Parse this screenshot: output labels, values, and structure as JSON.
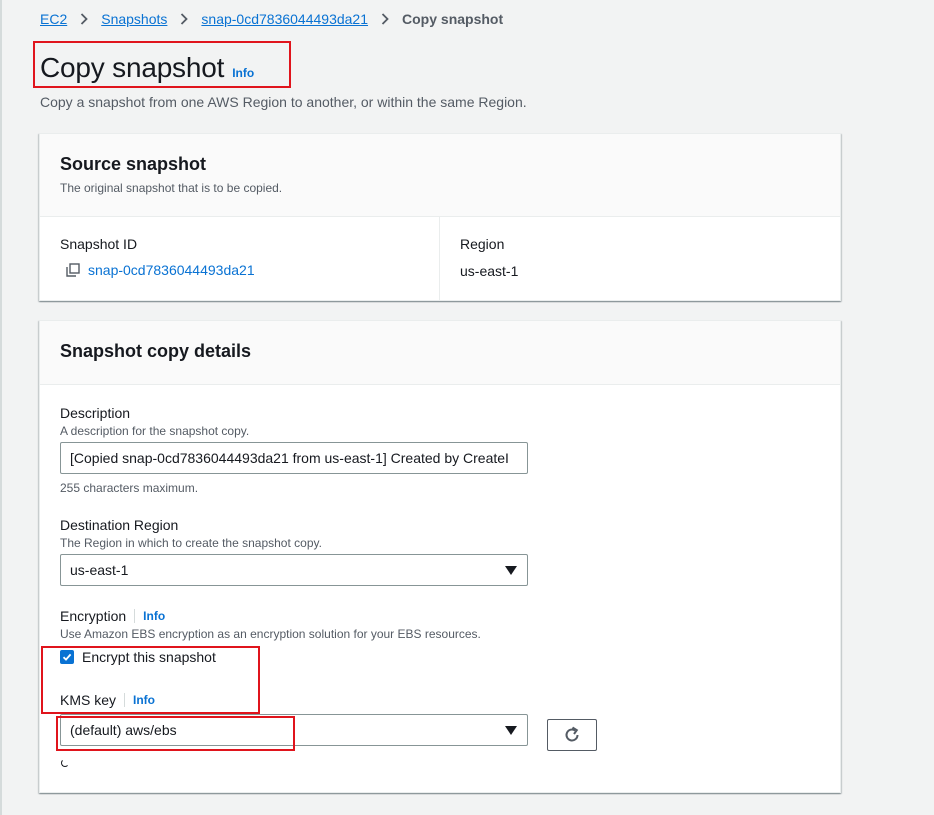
{
  "breadcrumb": {
    "items": [
      {
        "label": "EC2"
      },
      {
        "label": "Snapshots"
      },
      {
        "label": "snap-0cd7836044493da21"
      }
    ],
    "current": "Copy snapshot"
  },
  "header": {
    "title": "Copy snapshot",
    "info": "Info",
    "description": "Copy a snapshot from one AWS Region to another, or within the same Region."
  },
  "source": {
    "title": "Source snapshot",
    "description": "The original snapshot that is to be copied.",
    "snapshot_id_label": "Snapshot ID",
    "snapshot_id": "snap-0cd7836044493da21",
    "region_label": "Region",
    "region": "us-east-1"
  },
  "copy_details": {
    "title": "Snapshot copy details",
    "description_label": "Description",
    "description_help": "A description for the snapshot copy.",
    "description_value": "[Copied snap-0cd7836044493da21 from us-east-1] Created by CreateI",
    "description_constraint": "255 characters maximum.",
    "destination_label": "Destination Region",
    "destination_help": "The Region in which to create the snapshot copy.",
    "destination_value": "us-east-1",
    "encryption_label": "Encryption",
    "encryption_info": "Info",
    "encryption_help": "Use Amazon EBS encryption as an encryption solution for your EBS resources.",
    "encrypt_checkbox_label": "Encrypt this snapshot",
    "encrypt_checked": true,
    "kms_label": "KMS key",
    "kms_info": "Info",
    "kms_value": "(default) aws/ebs"
  },
  "colors": {
    "link": "#0972d3",
    "highlight": "#e0141c",
    "background": "#f2f3f3"
  },
  "icons": [
    "chevron-right-icon",
    "copy-icon",
    "caret-down-icon",
    "checkmark-icon",
    "refresh-icon",
    "loading-spinner-icon"
  ]
}
